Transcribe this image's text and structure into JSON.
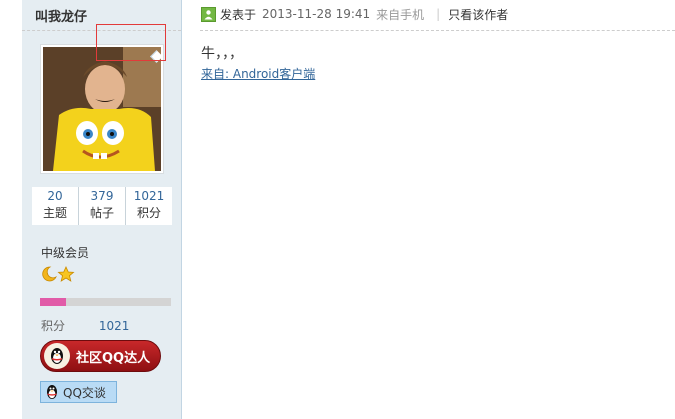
{
  "author": {
    "username": "叫我龙仔",
    "stats": [
      {
        "value": "20",
        "label": "主题"
      },
      {
        "value": "379",
        "label": "帖子"
      },
      {
        "value": "1021",
        "label": "积分"
      }
    ],
    "level": "中级会员",
    "level_icons": [
      "moon-icon",
      "star-icon"
    ],
    "progress_fraction": 0.2,
    "points_label": "积分",
    "points_value": "1021",
    "qq_expert_label": "社区QQ达人",
    "qq_chat_label": "QQ交谈"
  },
  "post": {
    "published_label": "发表于",
    "date": "2013-11-28 19:41",
    "from_label": "来自手机",
    "separator": "|",
    "only_author_label": "只看该作者",
    "content": "牛，，，",
    "source_link": "来自: Android客户端"
  },
  "colors": {
    "sidebar_bg": "#e5edf2",
    "link": "#336699",
    "progress_fill": "#e15ba8",
    "qq_expert_bg": "#b71c1f",
    "annotation_box": "#e23a3a"
  }
}
